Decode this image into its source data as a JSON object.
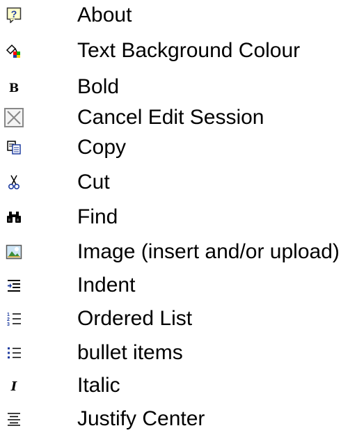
{
  "items": [
    {
      "label": "About",
      "icon": "help-balloon-icon"
    },
    {
      "label": "Text Background Colour",
      "icon": "highlight-colour-icon"
    },
    {
      "label": "Bold",
      "icon": "bold-icon"
    },
    {
      "label": "Cancel Edit Session",
      "icon": "cancel-icon"
    },
    {
      "label": "Copy",
      "icon": "copy-icon"
    },
    {
      "label": "Cut",
      "icon": "scissors-icon"
    },
    {
      "label": "Find",
      "icon": "binoculars-icon"
    },
    {
      "label": "Image (insert and/or upload)",
      "icon": "image-icon"
    },
    {
      "label": "Indent",
      "icon": "indent-icon"
    },
    {
      "label": "Ordered List",
      "icon": "ordered-list-icon"
    },
    {
      "label": "bullet items",
      "icon": "bullet-list-icon"
    },
    {
      "label": "Italic",
      "icon": "italic-icon"
    },
    {
      "label": "Justify Center",
      "icon": "justify-center-icon"
    }
  ],
  "colors": {
    "text": "#000000",
    "icon_blue": "#2b3f9e",
    "icon_gray": "#808080",
    "icon_yellow": "#ffffcc"
  }
}
